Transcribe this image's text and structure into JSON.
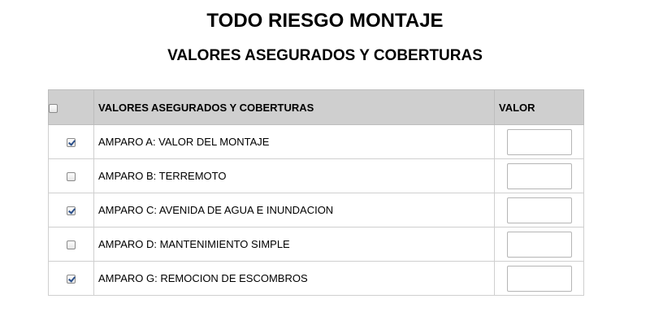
{
  "page": {
    "title": "TODO RIESGO MONTAJE",
    "subtitle": "VALORES  ASEGURADOS Y COBERTURAS"
  },
  "table": {
    "header": {
      "select_all_checked": false,
      "label": "VALORES ASEGURADOS Y COBERTURAS",
      "value": "VALOR"
    },
    "rows": [
      {
        "label": "AMPARO A: VALOR DEL MONTAJE",
        "checked": true,
        "value": ""
      },
      {
        "label": "AMPARO B: TERREMOTO",
        "checked": false,
        "value": ""
      },
      {
        "label": "AMPARO C: AVENIDA DE AGUA E INUNDACION",
        "checked": true,
        "value": ""
      },
      {
        "label": "AMPARO D: MANTENIMIENTO SIMPLE",
        "checked": false,
        "value": ""
      },
      {
        "label": "AMPARO G: REMOCION DE ESCOMBROS",
        "checked": true,
        "value": ""
      }
    ]
  }
}
